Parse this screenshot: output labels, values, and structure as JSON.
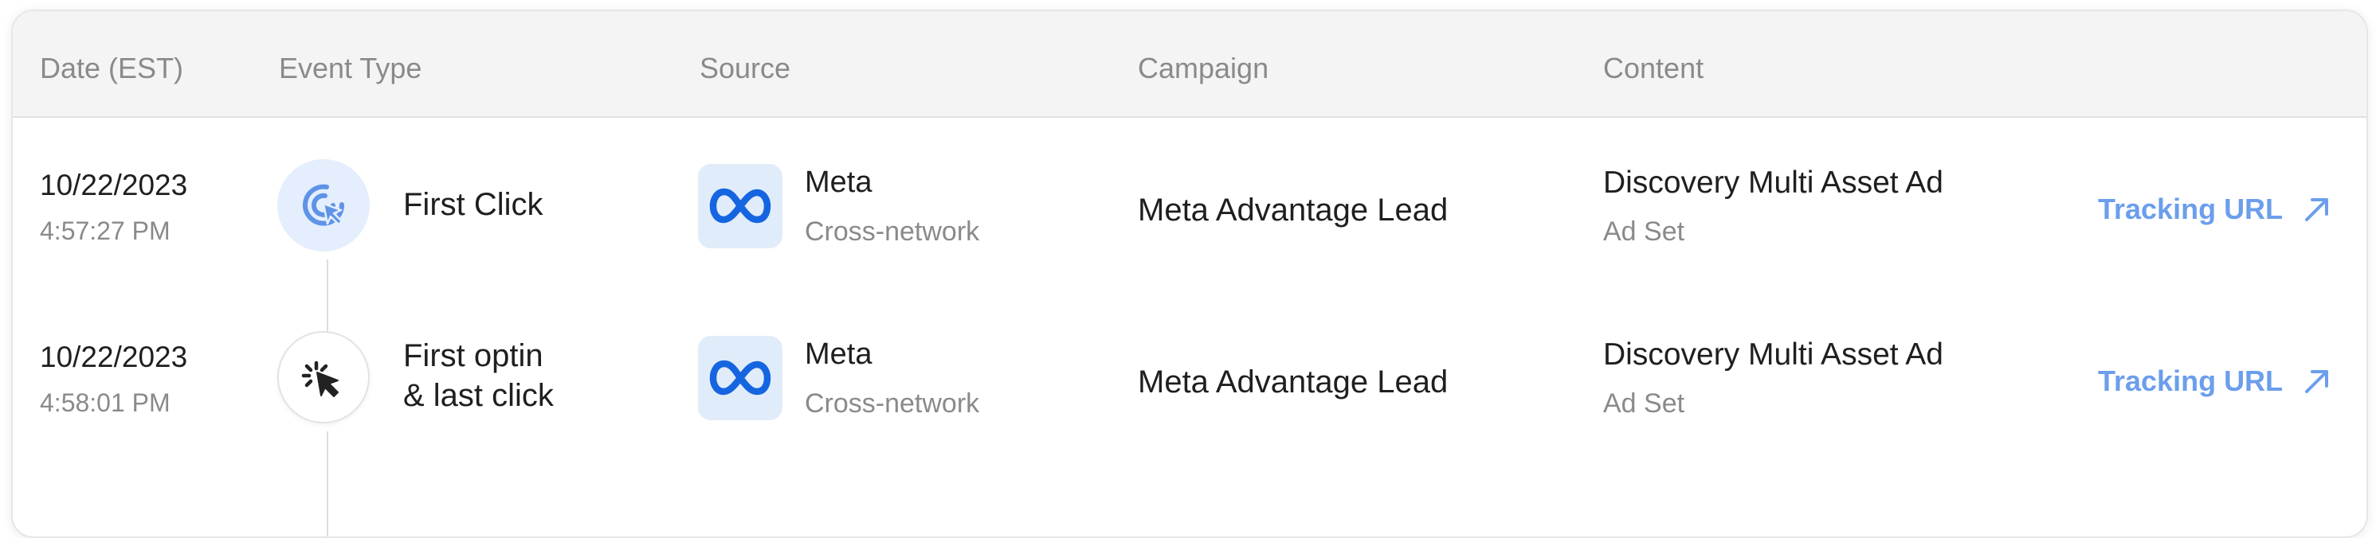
{
  "header": {
    "date": "Date (EST)",
    "event_type": "Event Type",
    "source": "Source",
    "campaign": "Campaign",
    "content": "Content"
  },
  "rows": [
    {
      "date": "10/22/2023",
      "time": "4:57:27 PM",
      "event_icon": "click-target-icon",
      "event_lines": [
        "First Click"
      ],
      "source_icon": "meta-logo-icon",
      "source_name": "Meta",
      "source_sub": "Cross-network",
      "campaign": "Meta Advantage Lead",
      "content_name": "Discovery Multi Asset Ad",
      "content_sub": "Ad Set",
      "link_label": "Tracking URL",
      "link_icon": "arrow-up-right-icon"
    },
    {
      "date": "10/22/2023",
      "time": "4:58:01 PM",
      "event_icon": "cursor-click-icon",
      "event_lines": [
        "First optin",
        "& last click"
      ],
      "source_icon": "meta-logo-icon",
      "source_name": "Meta",
      "source_sub": "Cross-network",
      "campaign": "Meta Advantage Lead",
      "content_name": "Discovery Multi Asset Ad",
      "content_sub": "Ad Set",
      "link_label": "Tracking URL",
      "link_icon": "arrow-up-right-icon"
    }
  ],
  "colors": {
    "accent": "#6b9eec",
    "meta_blue": "#1565e0",
    "header_bg": "#f4f4f4",
    "muted_text": "#8a8a8a"
  }
}
